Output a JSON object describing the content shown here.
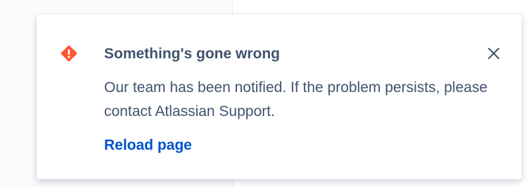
{
  "flag": {
    "icon": "error-warning-icon",
    "icon_color": "#ff5630",
    "title": "Something's gone wrong",
    "body": "Our team has been notified. If the problem persists, please contact Atlassian Support.",
    "action_label": "Reload page",
    "close_icon": "close-icon",
    "text_color": "#42526e",
    "link_color": "#0052cc"
  }
}
